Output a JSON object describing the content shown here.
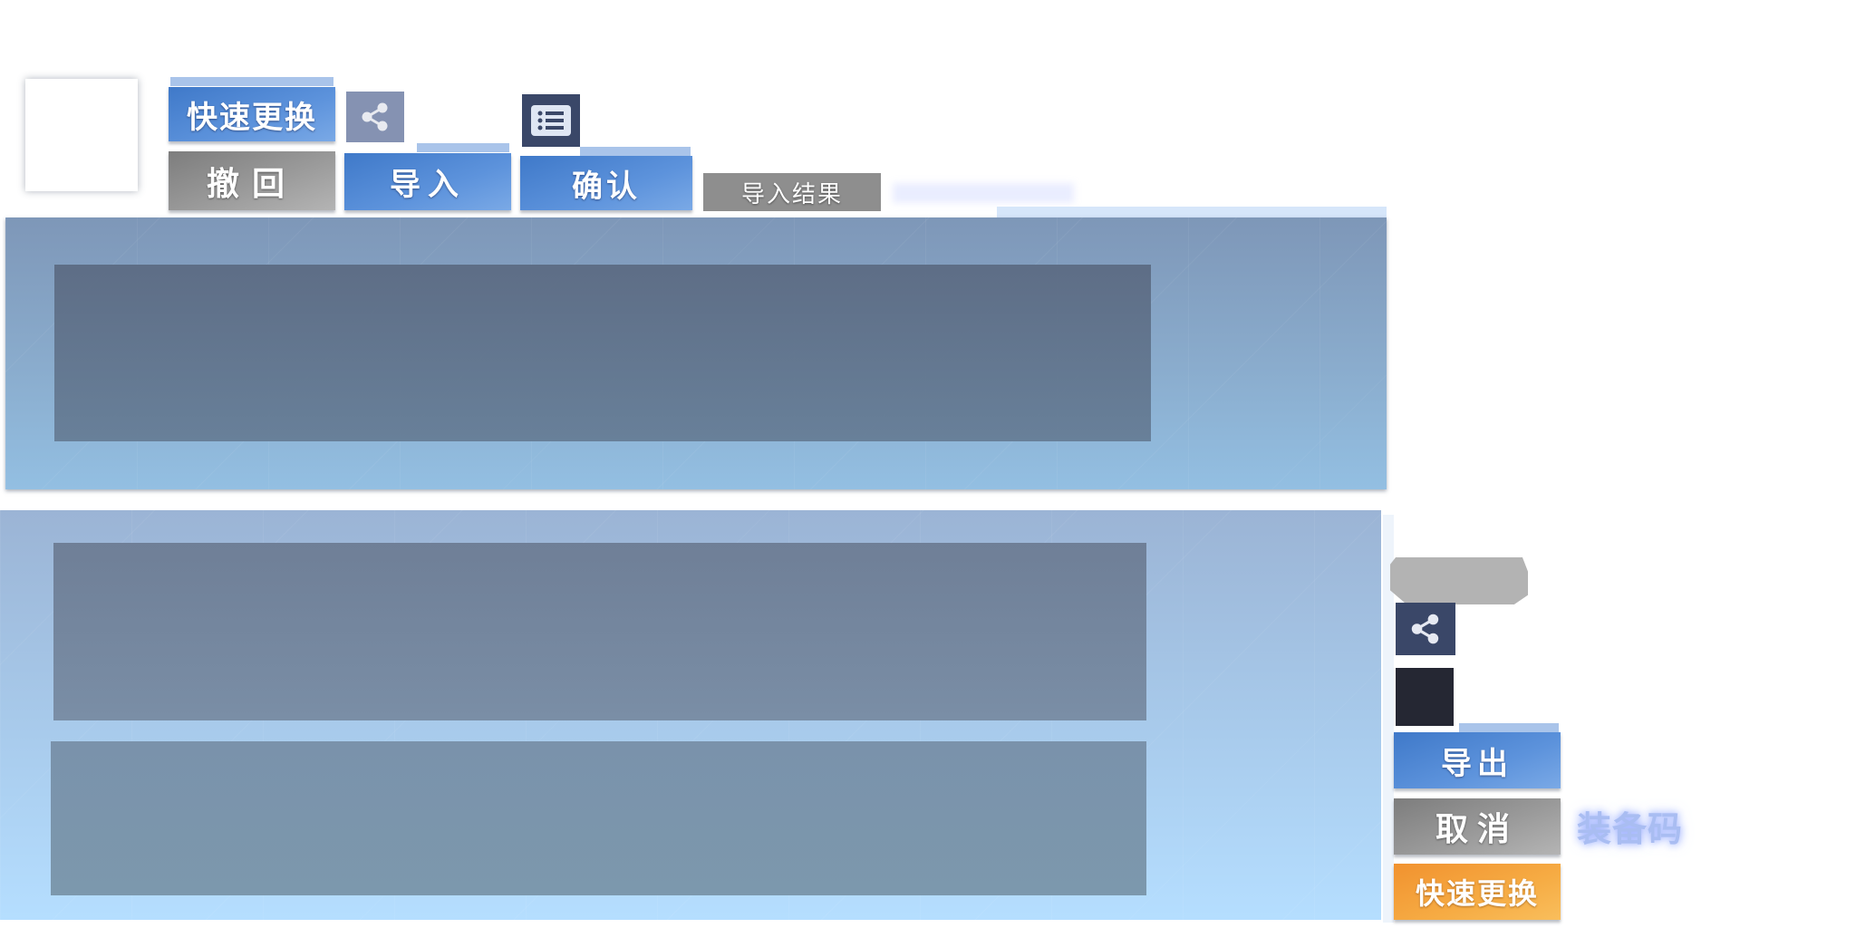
{
  "toolbar": {
    "quick_replace_label": "快速更换",
    "undo_label": "撤回",
    "import_label": "导入",
    "confirm_label": "确认",
    "import_result_label": "导入结果"
  },
  "side_panel": {
    "export_label": "导出",
    "cancel_label": "取消",
    "quick_replace_label": "快速更换",
    "equipment_code_label": "装备码"
  },
  "icons": {
    "share_top": "share-icon",
    "list": "list-icon",
    "share_side": "share-icon"
  },
  "colors": {
    "button_blue": "#4a84d4",
    "button_gray": "#8c8c8c",
    "button_orange": "#f5a23a",
    "icon_dark": "#3a4768",
    "panel_blue_top": "#7f9abb",
    "panel_blue_bottom": "#b5deff"
  }
}
